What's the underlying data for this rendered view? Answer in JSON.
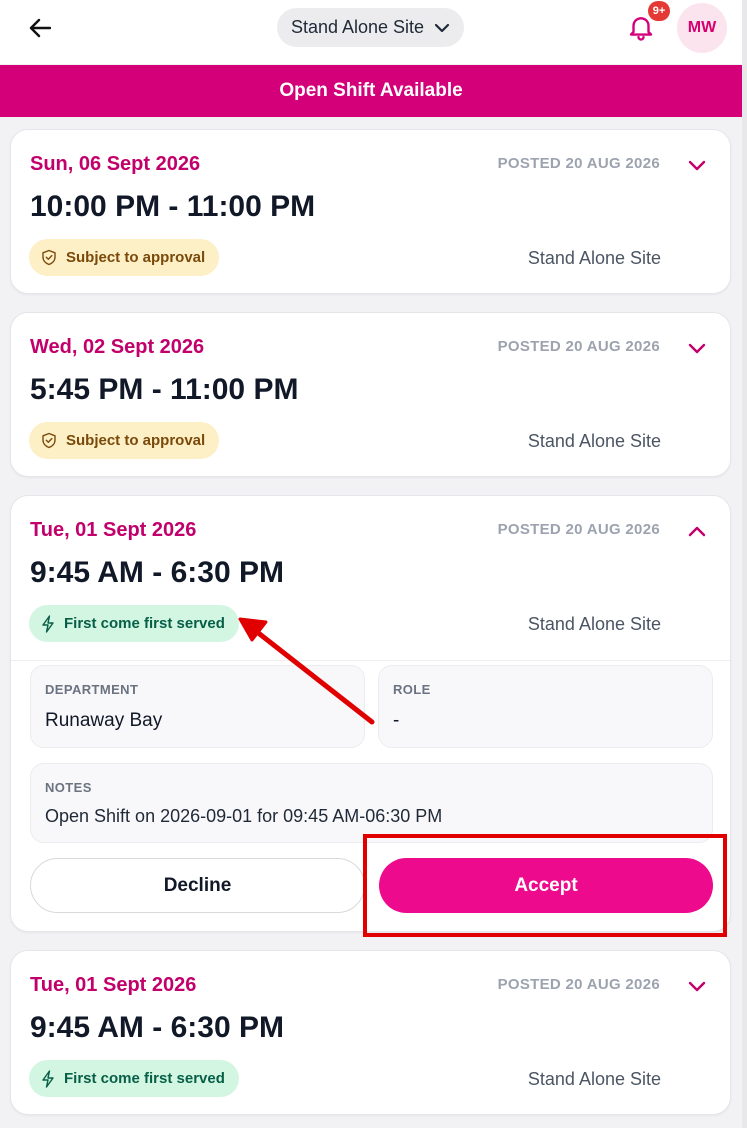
{
  "header": {
    "site_selector_label": "Stand Alone Site",
    "notification_badge": "9+",
    "avatar_initials": "MW"
  },
  "banner": {
    "title": "Open Shift Available"
  },
  "colors": {
    "brand": "#d4007a",
    "accent_button": "#ee0a8c",
    "date_text": "#c2006b",
    "annotation": "#e00000"
  },
  "shifts": [
    {
      "date": "Sun, 06 Sept 2026",
      "posted": "POSTED 20 AUG 2026",
      "time": "10:00 PM - 11:00 PM",
      "tag": "Subject to approval",
      "tag_icon": "shield-check-icon",
      "site": "Stand Alone Site",
      "expanded": false
    },
    {
      "date": "Wed, 02 Sept 2026",
      "posted": "POSTED 20 AUG 2026",
      "time": "5:45 PM - 11:00 PM",
      "tag": "Subject to approval",
      "tag_icon": "shield-check-icon",
      "site": "Stand Alone Site",
      "expanded": false
    },
    {
      "date": "Tue, 01 Sept 2026",
      "posted": "POSTED 20 AUG 2026",
      "time": "9:45 AM - 6:30 PM",
      "tag": "First come first served",
      "tag_icon": "lightning-icon",
      "site": "Stand Alone Site",
      "expanded": true,
      "details": {
        "department_label": "DEPARTMENT",
        "department_value": "Runaway Bay",
        "role_label": "ROLE",
        "role_value": "-",
        "notes_label": "NOTES",
        "notes_value": "Open Shift on 2026-09-01 for 09:45 AM-06:30 PM",
        "decline_label": "Decline",
        "accept_label": "Accept"
      }
    },
    {
      "date": "Tue, 01 Sept 2026",
      "posted": "POSTED 20 AUG 2026",
      "time": "9:45 AM - 6:30 PM",
      "tag": "First come first served",
      "tag_icon": "lightning-icon",
      "site": "Stand Alone Site",
      "expanded": false
    }
  ]
}
